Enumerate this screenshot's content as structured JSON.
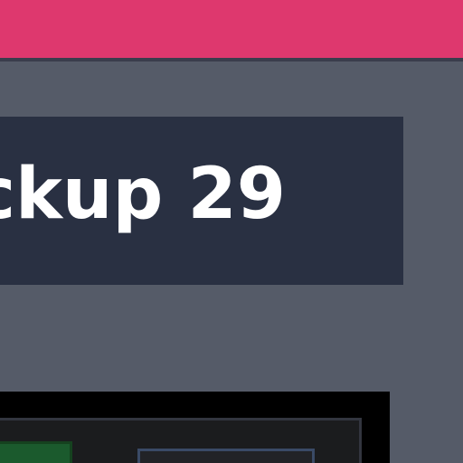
{
  "header": {
    "color": "#de386e"
  },
  "title_panel": {
    "text": "ckup 29"
  },
  "colors": {
    "background": "#555b68",
    "panel": "#293042",
    "title_text": "#ffffff",
    "preview_frame": "#000000",
    "preview_inner": "#1b1c1e",
    "preview_thumb": "#1b5a2d",
    "preview_box_border": "#3a4a66"
  }
}
